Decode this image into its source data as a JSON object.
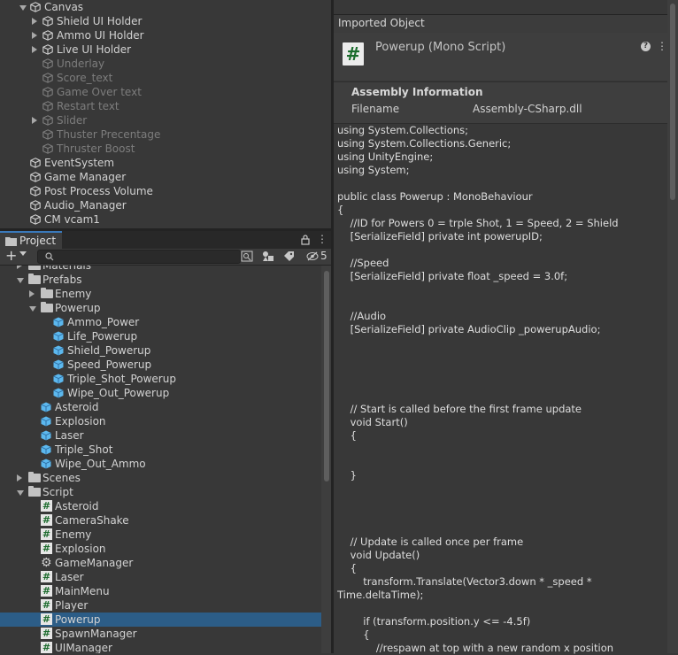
{
  "hierarchy": {
    "items": [
      {
        "label": "Canvas",
        "indent": 1,
        "arrow": "down",
        "dim": false
      },
      {
        "label": "Shield UI Holder",
        "indent": 2,
        "arrow": "right",
        "dim": false
      },
      {
        "label": "Ammo UI Holder",
        "indent": 2,
        "arrow": "right",
        "dim": false
      },
      {
        "label": "Live UI Holder",
        "indent": 2,
        "arrow": "right",
        "dim": false
      },
      {
        "label": "Underlay",
        "indent": 2,
        "arrow": "",
        "dim": true
      },
      {
        "label": "Score_text",
        "indent": 2,
        "arrow": "",
        "dim": true
      },
      {
        "label": "Game Over text",
        "indent": 2,
        "arrow": "",
        "dim": true
      },
      {
        "label": "Restart text",
        "indent": 2,
        "arrow": "",
        "dim": true
      },
      {
        "label": "Slider",
        "indent": 2,
        "arrow": "right",
        "dim": true
      },
      {
        "label": "Thuster Precentage",
        "indent": 2,
        "arrow": "",
        "dim": true
      },
      {
        "label": "Thruster Boost",
        "indent": 2,
        "arrow": "",
        "dim": true
      },
      {
        "label": "EventSystem",
        "indent": 1,
        "arrow": "",
        "dim": false
      },
      {
        "label": "Game Manager",
        "indent": 1,
        "arrow": "",
        "dim": false
      },
      {
        "label": "Post Process Volume",
        "indent": 1,
        "arrow": "",
        "dim": false
      },
      {
        "label": "Audio_Manager",
        "indent": 1,
        "arrow": "",
        "dim": false
      },
      {
        "label": "CM vcam1",
        "indent": 1,
        "arrow": "",
        "dim": false
      }
    ]
  },
  "project": {
    "tab_label": "Project",
    "hidden_count": "5",
    "items": [
      {
        "label": "Materials",
        "indent": 1,
        "icon": "folder",
        "arrow": "right"
      },
      {
        "label": "Prefabs",
        "indent": 1,
        "icon": "folder",
        "arrow": "down"
      },
      {
        "label": "Enemy",
        "indent": 2,
        "icon": "folder",
        "arrow": "right"
      },
      {
        "label": "Powerup",
        "indent": 2,
        "icon": "folder",
        "arrow": "down"
      },
      {
        "label": "Ammo_Power",
        "indent": 3,
        "icon": "prefab",
        "arrow": ""
      },
      {
        "label": "Life_Powerup",
        "indent": 3,
        "icon": "prefab",
        "arrow": ""
      },
      {
        "label": "Shield_Powerup",
        "indent": 3,
        "icon": "prefab",
        "arrow": ""
      },
      {
        "label": "Speed_Powerup",
        "indent": 3,
        "icon": "prefab",
        "arrow": ""
      },
      {
        "label": "Triple_Shot_Powerup",
        "indent": 3,
        "icon": "prefab",
        "arrow": ""
      },
      {
        "label": "Wipe_Out_Powerup",
        "indent": 3,
        "icon": "prefab",
        "arrow": ""
      },
      {
        "label": "Asteroid",
        "indent": 2,
        "icon": "prefab",
        "arrow": ""
      },
      {
        "label": "Explosion",
        "indent": 2,
        "icon": "prefab",
        "arrow": ""
      },
      {
        "label": "Laser",
        "indent": 2,
        "icon": "prefab",
        "arrow": ""
      },
      {
        "label": "Triple_Shot",
        "indent": 2,
        "icon": "prefab",
        "arrow": ""
      },
      {
        "label": "Wipe_Out_Ammo",
        "indent": 2,
        "icon": "prefab",
        "arrow": ""
      },
      {
        "label": "Scenes",
        "indent": 1,
        "icon": "folder",
        "arrow": "right"
      },
      {
        "label": "Script",
        "indent": 1,
        "icon": "folder",
        "arrow": "down"
      },
      {
        "label": "Asteroid",
        "indent": 2,
        "icon": "script",
        "arrow": ""
      },
      {
        "label": "CameraShake",
        "indent": 2,
        "icon": "script",
        "arrow": ""
      },
      {
        "label": "Enemy",
        "indent": 2,
        "icon": "script",
        "arrow": ""
      },
      {
        "label": "Explosion",
        "indent": 2,
        "icon": "script",
        "arrow": ""
      },
      {
        "label": "GameManager",
        "indent": 2,
        "icon": "gear",
        "arrow": ""
      },
      {
        "label": "Laser",
        "indent": 2,
        "icon": "script",
        "arrow": ""
      },
      {
        "label": "MainMenu",
        "indent": 2,
        "icon": "script",
        "arrow": ""
      },
      {
        "label": "Player",
        "indent": 2,
        "icon": "script",
        "arrow": ""
      },
      {
        "label": "Powerup",
        "indent": 2,
        "icon": "script",
        "arrow": "",
        "selected": true
      },
      {
        "label": "SpawnManager",
        "indent": 2,
        "icon": "script",
        "arrow": ""
      },
      {
        "label": "UIManager",
        "indent": 2,
        "icon": "script",
        "arrow": ""
      }
    ]
  },
  "inspector": {
    "header": "Imported Object",
    "title": "Powerup (Mono Script)",
    "assembly_title": "Assembly Information",
    "filename_label": "Filename",
    "filename_value": "Assembly-CSharp.dll",
    "code_lines": [
      "using System.Collections;",
      "using System.Collections.Generic;",
      "using UnityEngine;",
      "using System;",
      "",
      "public class Powerup : MonoBehaviour",
      "{",
      "    //ID for Powers 0 = trple Shot, 1 = Speed, 2 = Shield",
      "    [SerializeField] private int powerupID;",
      "",
      "    //Speed",
      "    [SerializeField] private float _speed = 3.0f;",
      "",
      "",
      "    //Audio",
      "    [SerializeField] private AudioClip _powerupAudio;",
      "",
      "",
      "",
      "",
      "",
      "    // Start is called before the first frame update",
      "    void Start()",
      "    {",
      "",
      "",
      "    }",
      "",
      "",
      "",
      "",
      "    // Update is called once per frame",
      "    void Update()",
      "    {",
      "        transform.Translate(Vector3.down * _speed *",
      "Time.deltaTime);",
      "",
      "        if (transform.position.y <= -4.5f)",
      "        {",
      "            //respawn at top with a new random x position"
    ]
  }
}
